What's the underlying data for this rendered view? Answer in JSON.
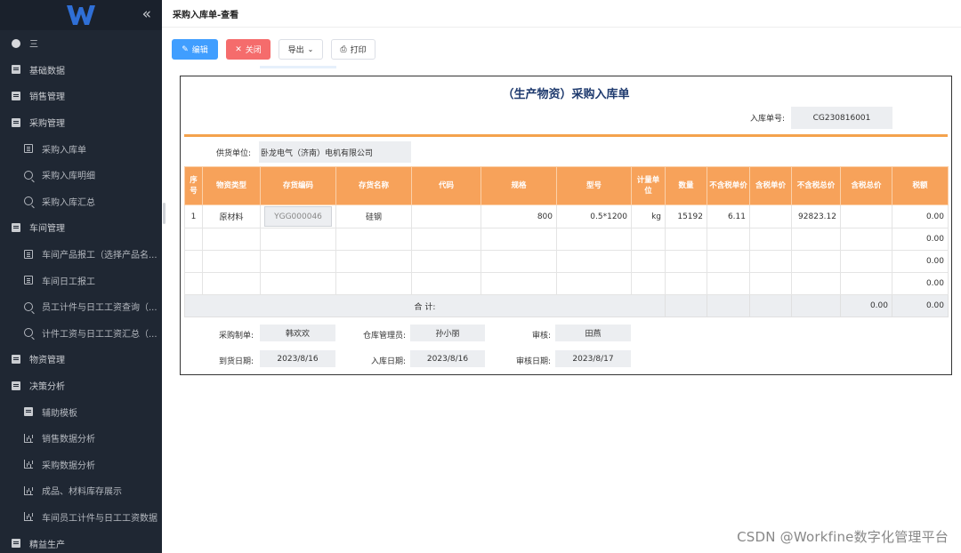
{
  "sidebar": {
    "items": [
      {
        "label": "三",
        "icon": "circle-icon",
        "level": 1
      },
      {
        "label": "基础数据",
        "icon": "doc-icon",
        "level": 1
      },
      {
        "label": "销售管理",
        "icon": "doc-icon",
        "level": 1
      },
      {
        "label": "采购管理",
        "icon": "doc-icon",
        "level": 1
      },
      {
        "label": "采购入库单",
        "icon": "page-icon",
        "level": 2
      },
      {
        "label": "采购入库明细",
        "icon": "search-icon",
        "level": 2
      },
      {
        "label": "采购入库汇总",
        "icon": "search-icon",
        "level": 2
      },
      {
        "label": "车间管理",
        "icon": "doc-icon",
        "level": 1
      },
      {
        "label": "车间产品报工（选择产品名...",
        "icon": "page-icon",
        "level": 2
      },
      {
        "label": "车间日工报工",
        "icon": "page-icon",
        "level": 2
      },
      {
        "label": "员工计件与日工工资查询（...",
        "icon": "search-icon",
        "level": 2
      },
      {
        "label": "计件工资与日工工资汇总（...",
        "icon": "search-icon",
        "level": 2
      },
      {
        "label": "物资管理",
        "icon": "doc-icon",
        "level": 1
      },
      {
        "label": "决策分析",
        "icon": "doc-icon",
        "level": 1
      },
      {
        "label": "辅助模板",
        "icon": "doc-icon",
        "level": 2
      },
      {
        "label": "销售数据分析",
        "icon": "chart-icon",
        "level": 2
      },
      {
        "label": "采购数据分析",
        "icon": "chart-icon",
        "level": 2
      },
      {
        "label": "成品、材料库存展示",
        "icon": "chart-icon",
        "level": 2
      },
      {
        "label": "车间员工计件与日工工资数据",
        "icon": "chart-icon",
        "level": 2
      },
      {
        "label": "精益生产",
        "icon": "doc-icon",
        "level": 1
      }
    ]
  },
  "header": {
    "title": "采购入库单-查看"
  },
  "toolbar": {
    "edit": "编辑",
    "close": "关闭",
    "export": "导出",
    "print": "打印"
  },
  "doc": {
    "title": "（生产物资）采购入库单",
    "order_label": "入库单号:",
    "order_no": "CG230816001",
    "supplier_label": "供货单位:",
    "supplier": "卧龙电气（济南）电机有限公司",
    "columns": [
      "序号",
      "物资类型",
      "存货编码",
      "存货名称",
      "代码",
      "规格",
      "型号",
      "计量单位",
      "数量",
      "不含税单价",
      "含税单价",
      "不含税总价",
      "含税总价",
      "税额"
    ],
    "rows": [
      {
        "no": "1",
        "type": "原材料",
        "code": "YGG000046",
        "name": "硅钢",
        "dcode": "",
        "spec": "800",
        "model": "0.5*1200",
        "unit": "kg",
        "qty": "15192",
        "price_ex": "6.11",
        "price_in": "",
        "total_ex": "92823.12",
        "total_in": "",
        "tax": "0.00"
      },
      {
        "no": "",
        "type": "",
        "code": "",
        "name": "",
        "dcode": "",
        "spec": "",
        "model": "",
        "unit": "",
        "qty": "",
        "price_ex": "",
        "price_in": "",
        "total_ex": "",
        "total_in": "",
        "tax": "0.00"
      },
      {
        "no": "",
        "type": "",
        "code": "",
        "name": "",
        "dcode": "",
        "spec": "",
        "model": "",
        "unit": "",
        "qty": "",
        "price_ex": "",
        "price_in": "",
        "total_ex": "",
        "total_in": "",
        "tax": "0.00"
      },
      {
        "no": "",
        "type": "",
        "code": "",
        "name": "",
        "dcode": "",
        "spec": "",
        "model": "",
        "unit": "",
        "qty": "",
        "price_ex": "",
        "price_in": "",
        "total_ex": "",
        "total_in": "",
        "tax": "0.00"
      }
    ],
    "total_label": "合 计:",
    "total_in": "0.00",
    "total_tax": "0.00",
    "footer": {
      "maker_label": "采购制单:",
      "maker": "韩欢欢",
      "keeper_label": "仓库管理员:",
      "keeper": "孙小丽",
      "auditor_label": "审核:",
      "auditor": "田燕",
      "arrive_label": "到货日期:",
      "arrive": "2023/8/16",
      "instock_label": "入库日期:",
      "instock": "2023/8/16",
      "audit_date_label": "审核日期:",
      "audit_date": "2023/8/17"
    }
  },
  "watermark": "CSDN @Workfine数字化管理平台",
  "colors": {
    "sidebar_bg": "#1f2733",
    "primary": "#409eff",
    "danger": "#f56c6c",
    "table_header": "#f7a25a",
    "title": "#1e3a6e"
  }
}
